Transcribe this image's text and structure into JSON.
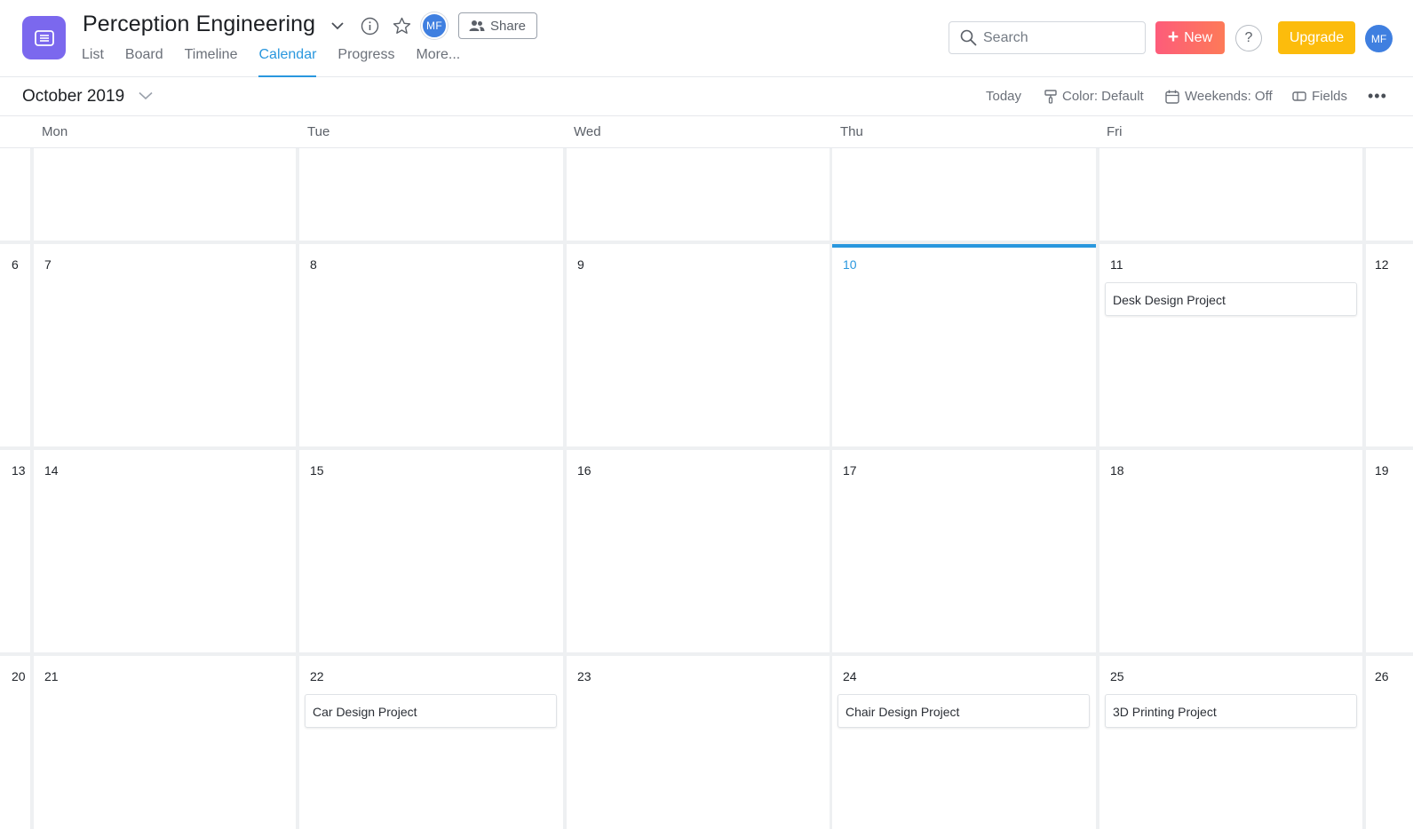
{
  "header": {
    "project_title": "Perception Engineering",
    "member_initials": "MF",
    "share_label": "Share",
    "tabs": [
      {
        "label": "List"
      },
      {
        "label": "Board"
      },
      {
        "label": "Timeline"
      },
      {
        "label": "Calendar",
        "active": true
      },
      {
        "label": "Progress"
      },
      {
        "label": "More..."
      }
    ],
    "search_placeholder": "Search",
    "new_label": "New",
    "help_label": "?",
    "upgrade_label": "Upgrade",
    "user_initials": "MF",
    "colors": {
      "accent": "#2997de",
      "logo": "#7b68ee",
      "new_button": "#fd6a6a",
      "upgrade_button": "#fcbc0c",
      "avatar": "#3f7fe0"
    }
  },
  "toolbar": {
    "month": "October 2019",
    "today_label": "Today",
    "color_label": "Color: Default",
    "weekends_label": "Weekends: Off",
    "fields_label": "Fields",
    "more_label": "•••"
  },
  "calendar": {
    "weekdays": [
      "Mon",
      "Tue",
      "Wed",
      "Thu",
      "Fri"
    ],
    "today": "10",
    "weeks": [
      {
        "left_num": "",
        "right_num": "",
        "days": [
          "",
          "",
          "",
          "",
          ""
        ]
      },
      {
        "left_num": "6",
        "right_num": "12",
        "days": [
          "7",
          "8",
          "9",
          "10",
          "11"
        ]
      },
      {
        "left_num": "13",
        "right_num": "19",
        "days": [
          "14",
          "15",
          "16",
          "17",
          "18"
        ]
      },
      {
        "left_num": "20",
        "right_num": "26",
        "days": [
          "21",
          "22",
          "23",
          "24",
          "25"
        ]
      }
    ],
    "tasks": [
      {
        "title": "Desk Design Project",
        "day": "11"
      },
      {
        "title": "Car Design Project",
        "day": "22"
      },
      {
        "title": "Chair Design Project",
        "day": "24"
      },
      {
        "title": "3D Printing Project",
        "day": "25"
      }
    ]
  }
}
